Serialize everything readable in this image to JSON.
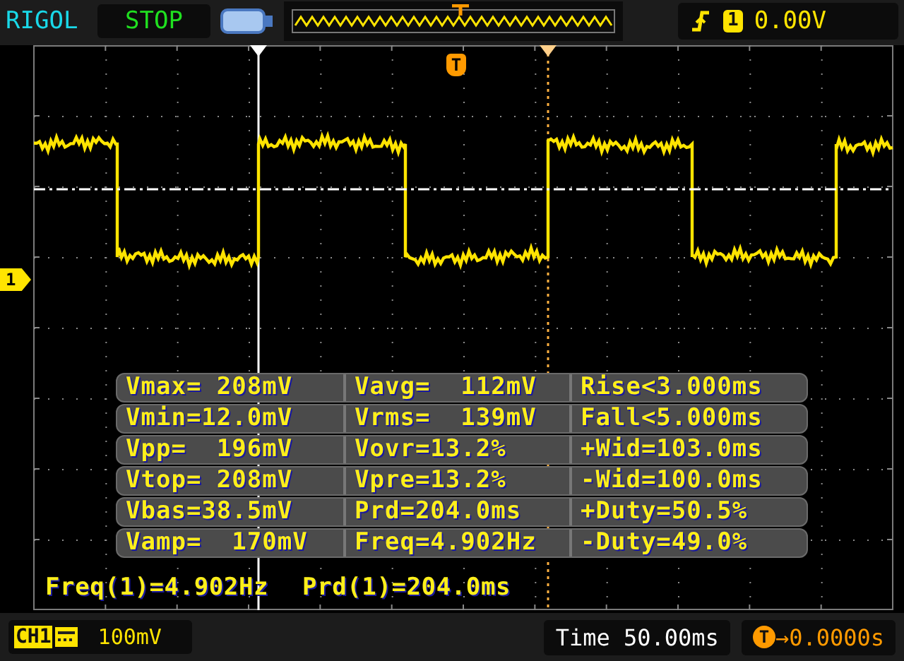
{
  "brand": "RIGOL",
  "run_state": "STOP",
  "trigger": {
    "source": "1",
    "trigger_level": "0.00V"
  },
  "trigger_marker": {
    "label": "T"
  },
  "channel_marker": {
    "label": "1"
  },
  "measurements": [
    [
      "Vmax= 208mV",
      "Vavg=  112mV",
      "Rise<3.000ms"
    ],
    [
      "Vmin=12.0mV",
      "Vrms=  139mV",
      "Fall<5.000ms"
    ],
    [
      "Vpp=  196mV",
      "Vovr=13.2%",
      "+Wid=103.0ms"
    ],
    [
      "Vtop= 208mV",
      "Vpre=13.2%",
      "-Wid=100.0ms"
    ],
    [
      "Vbas=38.5mV",
      "Prd=204.0ms",
      "+Duty=50.5%"
    ],
    [
      "Vamp=  170mV",
      "Freq=4.902Hz",
      "-Duty=49.0%"
    ]
  ],
  "readouts": [
    "Freq(1)=4.902Hz",
    "Prd(1)=204.0ms"
  ],
  "status_bar": {
    "channel": "CH1",
    "scale": "100mV",
    "timebase": "Time 50.00ms",
    "trigger_offset_label": "T",
    "trigger_offset": "→0.0000s"
  }
}
